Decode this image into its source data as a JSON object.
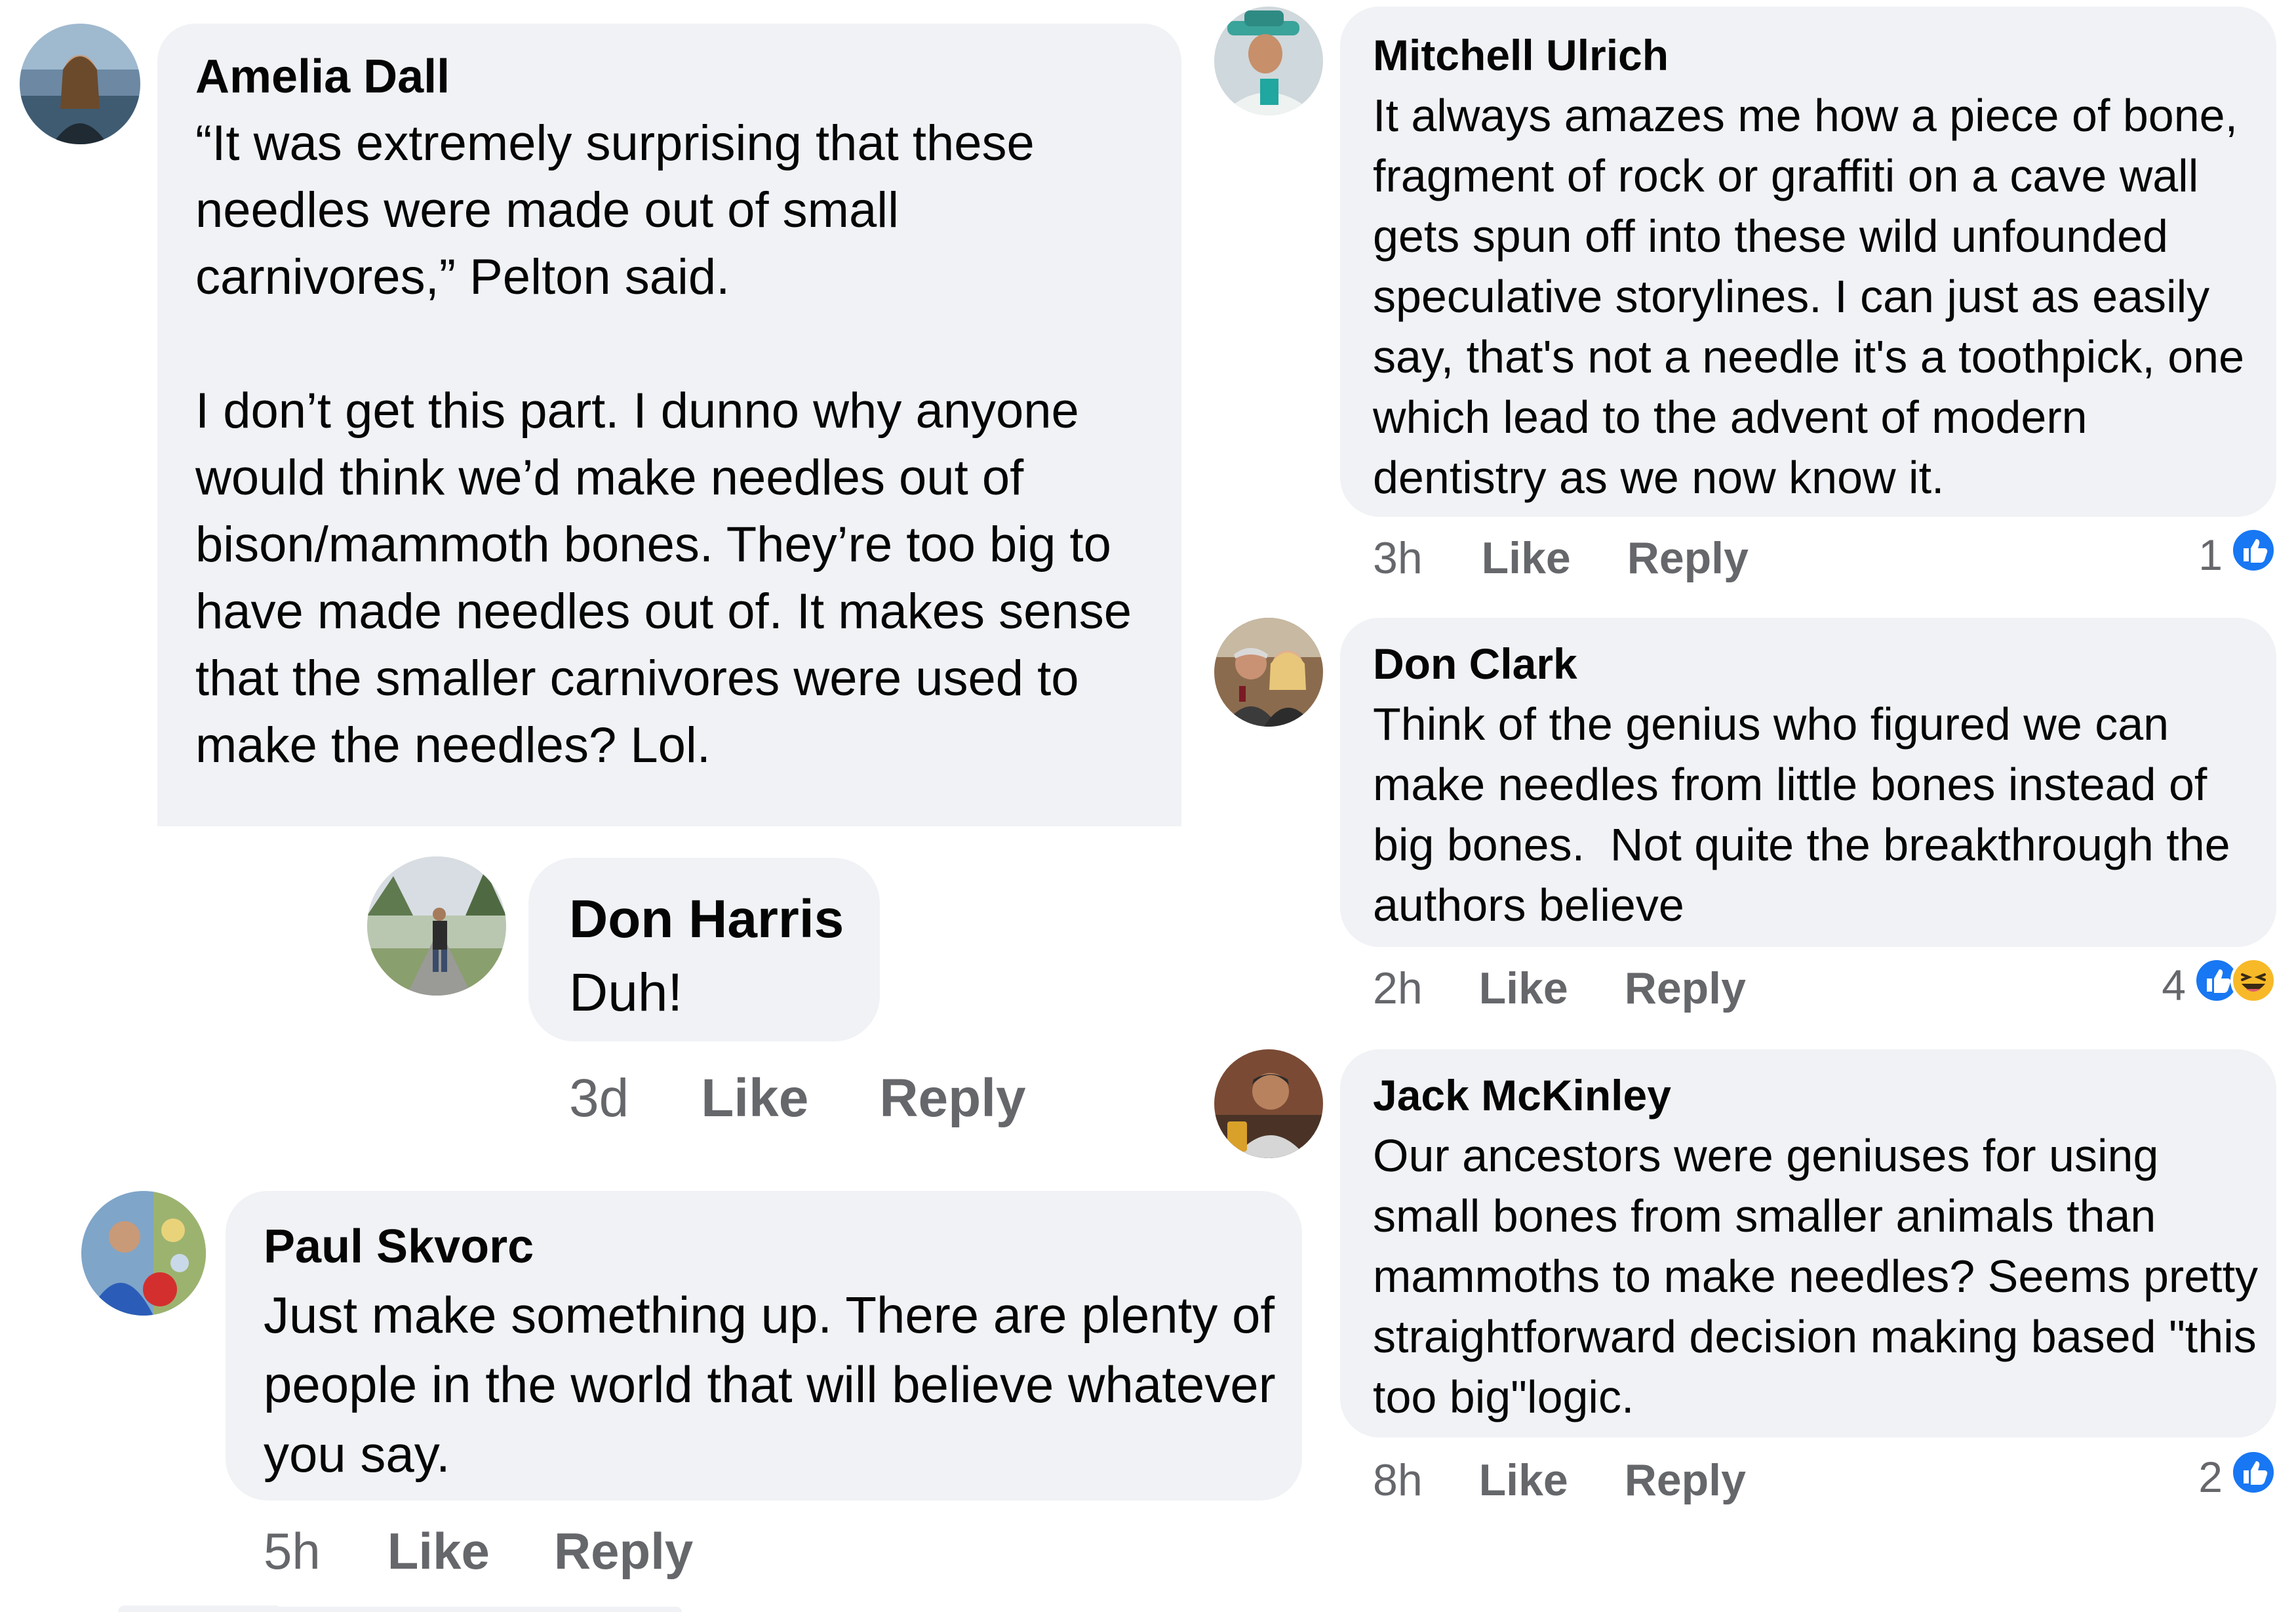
{
  "comments": {
    "amelia": {
      "name": "Amelia Dall",
      "text": "“It was extremely surprising that these needles were made out of small carnivores,” Pelton said.\n\nI don’t get this part. I dunno why anyone would think we’d make needles out of bison/mammoth bones. They’re too big to have made needles out of. It makes sense that the smaller carnivores were used to make the needles? Lol."
    },
    "don_harris": {
      "name": "Don Harris",
      "text": "Duh!",
      "time": "3d",
      "like": "Like",
      "reply": "Reply"
    },
    "paul": {
      "name": "Paul Skvorc",
      "text": "Just make something up. There are plenty of people in the world that will believe whatever you say.",
      "time": "5h",
      "like": "Like",
      "reply": "Reply"
    },
    "mitchell": {
      "name": "Mitchell Ulrich",
      "text": "It always amazes me how a piece of bone, fragment of rock or graffiti on a cave wall gets spun off into these wild unfounded speculative storylines. I can just as easily say, that's not a needle it's a toothpick, one which lead to the advent of modern dentistry as we now know it.",
      "time": "3h",
      "like": "Like",
      "reply": "Reply",
      "reactions": "1"
    },
    "don_clark": {
      "name": "Don Clark",
      "text": "Think of the genius who figured we can make needles from little bones instead of big bones.  Not quite the breakthrough the authors believe",
      "time": "2h",
      "like": "Like",
      "reply": "Reply",
      "reactions": "4"
    },
    "jack": {
      "name": "Jack McKinley",
      "text": "Our ancestors were geniuses for using small bones from smaller animals than mammoths to make needles? Seems pretty straightforward decision making based \"this too big\"logic.",
      "time": "8h",
      "like": "Like",
      "reply": "Reply",
      "reactions": "2"
    }
  },
  "colors": {
    "bubble": "#f0f2f5",
    "meta_text": "#65676b",
    "like_blue": "#1877f2",
    "haha_yellow": "#f7b928"
  },
  "icons": [
    "like-reaction-icon",
    "haha-reaction-icon"
  ]
}
